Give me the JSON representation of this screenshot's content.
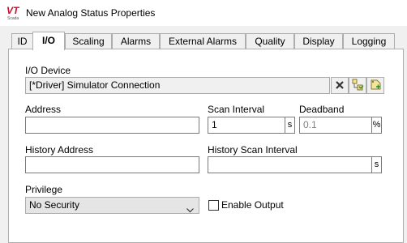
{
  "window": {
    "title": "New Analog Status Properties",
    "logo_text": "VT",
    "logo_sub": "Scada"
  },
  "tabs": [
    {
      "label": "ID"
    },
    {
      "label": "I/O"
    },
    {
      "label": "Scaling"
    },
    {
      "label": "Alarms"
    },
    {
      "label": "External Alarms"
    },
    {
      "label": "Quality"
    },
    {
      "label": "Display"
    },
    {
      "label": "Logging"
    }
  ],
  "io": {
    "io_device_label": "I/O Device",
    "io_device_value": "[*Driver]    Simulator Connection",
    "address_label": "Address",
    "address_value": "",
    "scan_interval_label": "Scan Interval",
    "scan_interval_value": "1",
    "scan_interval_unit": "s",
    "deadband_label": "Deadband",
    "deadband_value": "0.1",
    "deadband_unit": "%",
    "history_address_label": "History Address",
    "history_address_value": "",
    "history_scan_interval_label": "History Scan Interval",
    "history_scan_interval_value": "",
    "history_scan_interval_unit": "s",
    "privilege_label": "Privilege",
    "privilege_value": "No Security",
    "enable_output_label": "Enable Output"
  },
  "colors": {
    "accent": "#c8102e",
    "panel": "#ffffff",
    "background": "#f0f0f0"
  }
}
